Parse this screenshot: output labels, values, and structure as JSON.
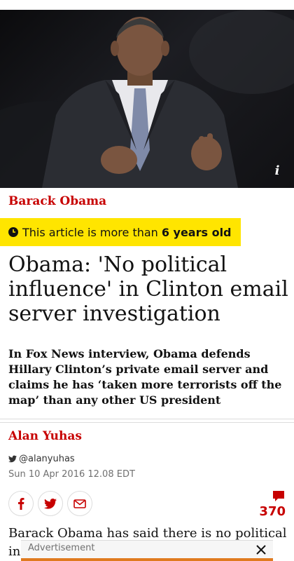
{
  "hero": {
    "info_icon": "info-icon",
    "info_label": "i"
  },
  "article": {
    "kicker": "Barack Obama",
    "age_notice": {
      "prefix": "This article is more than",
      "age": "6 years old",
      "icon": "clock-icon"
    },
    "headline": "Obama: 'No political influence' in Clinton email server investigation",
    "standfirst": "In Fox News interview, Obama defends Hillary Clinton’s private email server and claims he has ‘taken more terrorists off the map’ than any other US president",
    "author": "Alan Yuhas",
    "twitter_handle": "@alanyuhas",
    "published": "Sun 10 Apr 2016 12.08 EDT",
    "share_icons": [
      "facebook-icon",
      "twitter-icon",
      "email-icon"
    ],
    "comment_count": "370",
    "body_start": "Barack Obama has said there is no political in"
  },
  "ad": {
    "label": "Advertisement",
    "close_icon": "close-icon"
  },
  "colors": {
    "accent_red": "#c70000",
    "age_banner_yellow": "#ffe500",
    "ad_strip": "#e07a1f"
  }
}
